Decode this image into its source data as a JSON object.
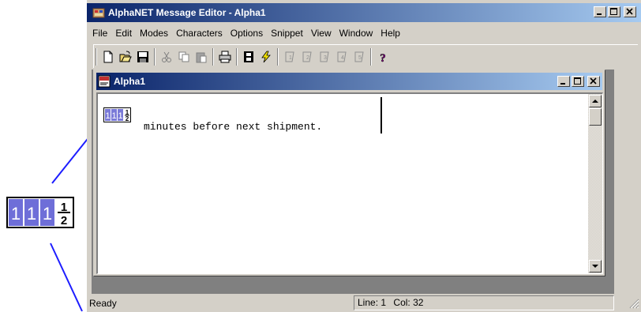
{
  "window": {
    "title": "AlphaNET Message Editor - Alpha1"
  },
  "menu": [
    "File",
    "Edit",
    "Modes",
    "Characters",
    "Options",
    "Snippet",
    "View",
    "Window",
    "Help"
  ],
  "document": {
    "title": "Alpha1",
    "text": "minutes before next shipment.",
    "inline_char": "111½"
  },
  "status": {
    "message": "Ready",
    "line_label": "Line:",
    "line": "1",
    "col_label": "Col:",
    "col": "32"
  },
  "colors": {
    "title_active": "#0a246a",
    "title_gradient_end": "#a6caf0",
    "chrome": "#d4d0c8",
    "callout_line": "#0000ff",
    "glyph_fill": "#6e6ed8"
  },
  "icons": [
    "new-file-icon",
    "open-folder-icon",
    "save-disk-icon",
    "cut-icon",
    "copy-icon",
    "paste-icon",
    "print-icon",
    "film-icon",
    "lightning-icon",
    "page-1-icon",
    "page-2-icon",
    "page-3-icon",
    "page-4-icon",
    "page-5-icon",
    "help-question-icon"
  ]
}
